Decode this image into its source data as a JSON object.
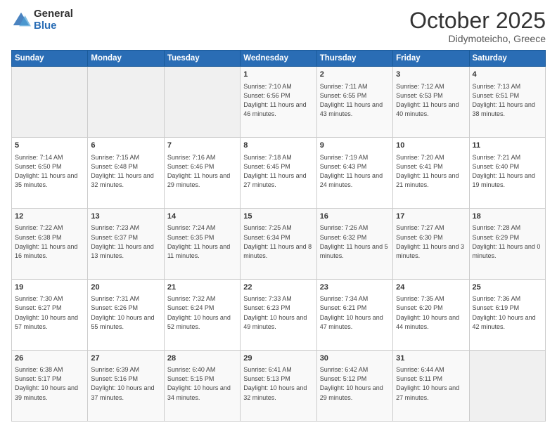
{
  "header": {
    "logo_general": "General",
    "logo_blue": "Blue",
    "month": "October 2025",
    "location": "Didymoteicho, Greece"
  },
  "days_of_week": [
    "Sunday",
    "Monday",
    "Tuesday",
    "Wednesday",
    "Thursday",
    "Friday",
    "Saturday"
  ],
  "weeks": [
    [
      {
        "day": "",
        "info": ""
      },
      {
        "day": "",
        "info": ""
      },
      {
        "day": "",
        "info": ""
      },
      {
        "day": "1",
        "info": "Sunrise: 7:10 AM\nSunset: 6:56 PM\nDaylight: 11 hours and 46 minutes."
      },
      {
        "day": "2",
        "info": "Sunrise: 7:11 AM\nSunset: 6:55 PM\nDaylight: 11 hours and 43 minutes."
      },
      {
        "day": "3",
        "info": "Sunrise: 7:12 AM\nSunset: 6:53 PM\nDaylight: 11 hours and 40 minutes."
      },
      {
        "day": "4",
        "info": "Sunrise: 7:13 AM\nSunset: 6:51 PM\nDaylight: 11 hours and 38 minutes."
      }
    ],
    [
      {
        "day": "5",
        "info": "Sunrise: 7:14 AM\nSunset: 6:50 PM\nDaylight: 11 hours and 35 minutes."
      },
      {
        "day": "6",
        "info": "Sunrise: 7:15 AM\nSunset: 6:48 PM\nDaylight: 11 hours and 32 minutes."
      },
      {
        "day": "7",
        "info": "Sunrise: 7:16 AM\nSunset: 6:46 PM\nDaylight: 11 hours and 29 minutes."
      },
      {
        "day": "8",
        "info": "Sunrise: 7:18 AM\nSunset: 6:45 PM\nDaylight: 11 hours and 27 minutes."
      },
      {
        "day": "9",
        "info": "Sunrise: 7:19 AM\nSunset: 6:43 PM\nDaylight: 11 hours and 24 minutes."
      },
      {
        "day": "10",
        "info": "Sunrise: 7:20 AM\nSunset: 6:41 PM\nDaylight: 11 hours and 21 minutes."
      },
      {
        "day": "11",
        "info": "Sunrise: 7:21 AM\nSunset: 6:40 PM\nDaylight: 11 hours and 19 minutes."
      }
    ],
    [
      {
        "day": "12",
        "info": "Sunrise: 7:22 AM\nSunset: 6:38 PM\nDaylight: 11 hours and 16 minutes."
      },
      {
        "day": "13",
        "info": "Sunrise: 7:23 AM\nSunset: 6:37 PM\nDaylight: 11 hours and 13 minutes."
      },
      {
        "day": "14",
        "info": "Sunrise: 7:24 AM\nSunset: 6:35 PM\nDaylight: 11 hours and 11 minutes."
      },
      {
        "day": "15",
        "info": "Sunrise: 7:25 AM\nSunset: 6:34 PM\nDaylight: 11 hours and 8 minutes."
      },
      {
        "day": "16",
        "info": "Sunrise: 7:26 AM\nSunset: 6:32 PM\nDaylight: 11 hours and 5 minutes."
      },
      {
        "day": "17",
        "info": "Sunrise: 7:27 AM\nSunset: 6:30 PM\nDaylight: 11 hours and 3 minutes."
      },
      {
        "day": "18",
        "info": "Sunrise: 7:28 AM\nSunset: 6:29 PM\nDaylight: 11 hours and 0 minutes."
      }
    ],
    [
      {
        "day": "19",
        "info": "Sunrise: 7:30 AM\nSunset: 6:27 PM\nDaylight: 10 hours and 57 minutes."
      },
      {
        "day": "20",
        "info": "Sunrise: 7:31 AM\nSunset: 6:26 PM\nDaylight: 10 hours and 55 minutes."
      },
      {
        "day": "21",
        "info": "Sunrise: 7:32 AM\nSunset: 6:24 PM\nDaylight: 10 hours and 52 minutes."
      },
      {
        "day": "22",
        "info": "Sunrise: 7:33 AM\nSunset: 6:23 PM\nDaylight: 10 hours and 49 minutes."
      },
      {
        "day": "23",
        "info": "Sunrise: 7:34 AM\nSunset: 6:21 PM\nDaylight: 10 hours and 47 minutes."
      },
      {
        "day": "24",
        "info": "Sunrise: 7:35 AM\nSunset: 6:20 PM\nDaylight: 10 hours and 44 minutes."
      },
      {
        "day": "25",
        "info": "Sunrise: 7:36 AM\nSunset: 6:19 PM\nDaylight: 10 hours and 42 minutes."
      }
    ],
    [
      {
        "day": "26",
        "info": "Sunrise: 6:38 AM\nSunset: 5:17 PM\nDaylight: 10 hours and 39 minutes."
      },
      {
        "day": "27",
        "info": "Sunrise: 6:39 AM\nSunset: 5:16 PM\nDaylight: 10 hours and 37 minutes."
      },
      {
        "day": "28",
        "info": "Sunrise: 6:40 AM\nSunset: 5:15 PM\nDaylight: 10 hours and 34 minutes."
      },
      {
        "day": "29",
        "info": "Sunrise: 6:41 AM\nSunset: 5:13 PM\nDaylight: 10 hours and 32 minutes."
      },
      {
        "day": "30",
        "info": "Sunrise: 6:42 AM\nSunset: 5:12 PM\nDaylight: 10 hours and 29 minutes."
      },
      {
        "day": "31",
        "info": "Sunrise: 6:44 AM\nSunset: 5:11 PM\nDaylight: 10 hours and 27 minutes."
      },
      {
        "day": "",
        "info": ""
      }
    ]
  ]
}
